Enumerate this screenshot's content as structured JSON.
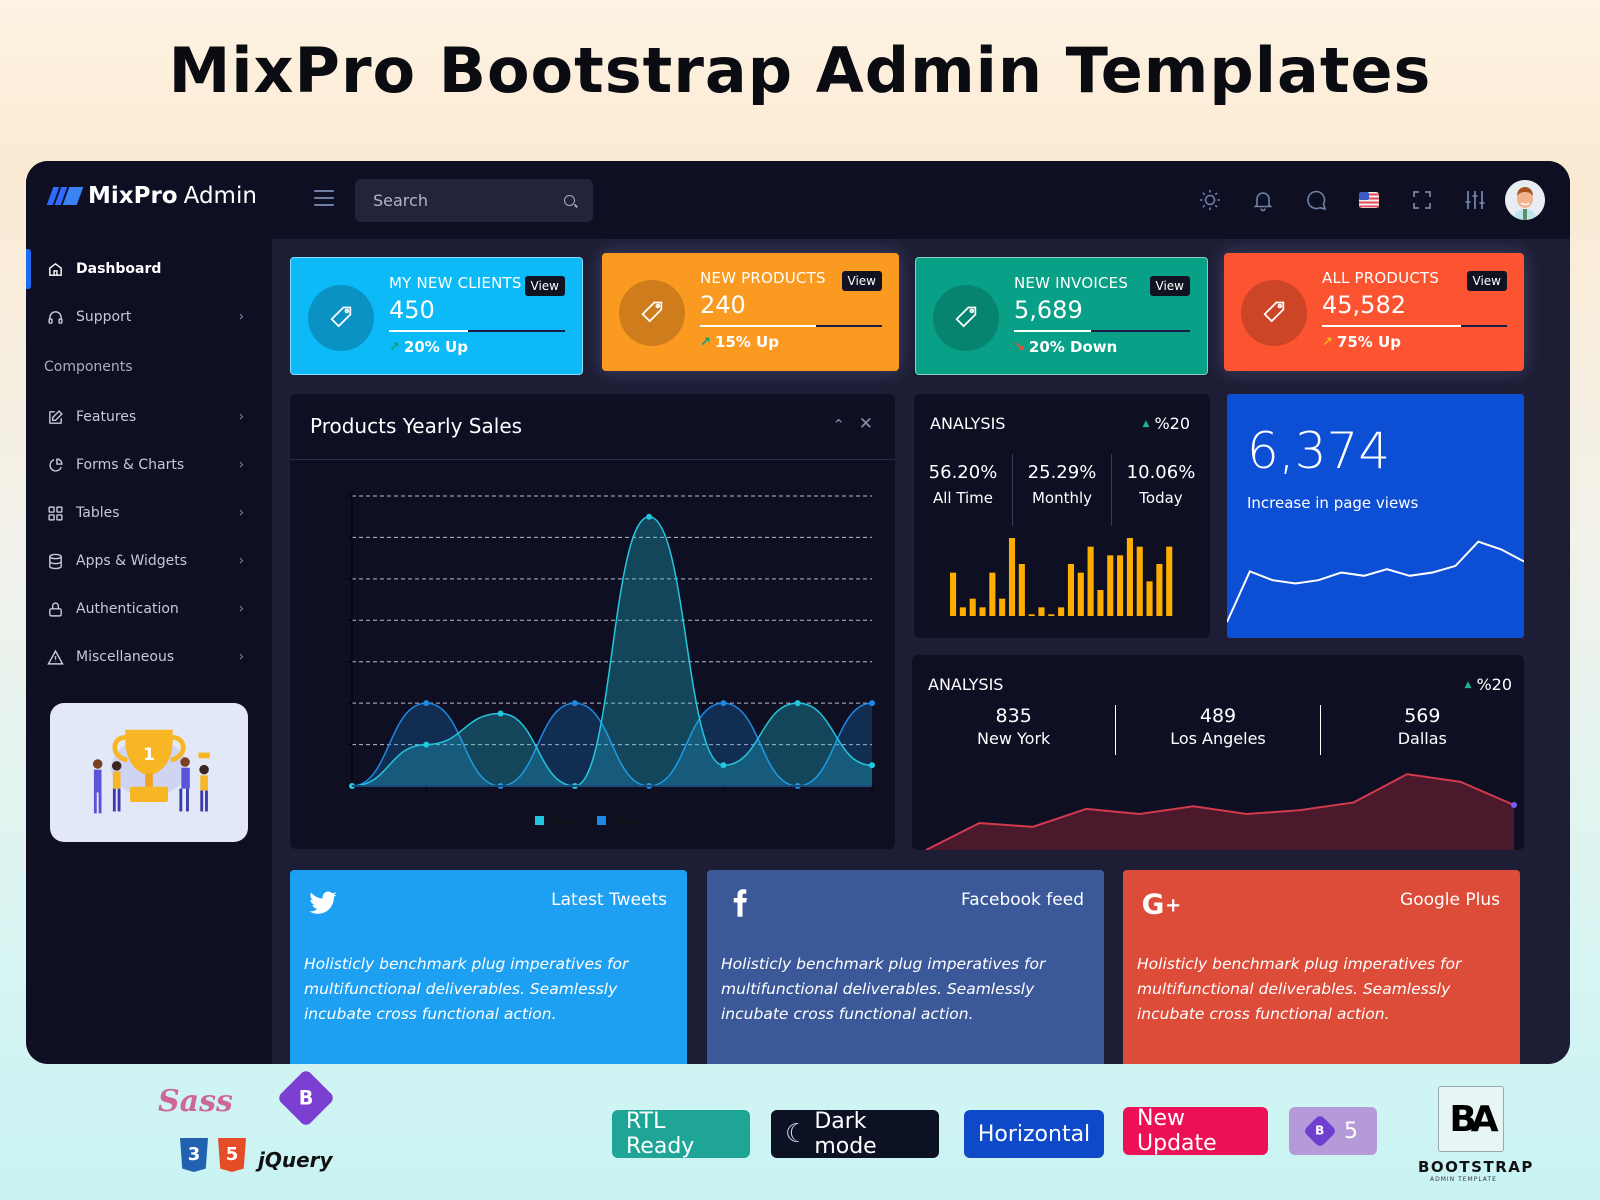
{
  "promo": {
    "title": "MixPro Bootstrap Admin Templates",
    "badges": [
      {
        "label": "RTL Ready",
        "color": "#1fa596"
      },
      {
        "label": "Dark mode",
        "color": "#0d1124"
      },
      {
        "label": "Horizontal",
        "color": "#0d49c8"
      },
      {
        "label": "New Update",
        "color": "#ec1057"
      },
      {
        "label": "5",
        "color": "#b49ad9"
      }
    ],
    "tech_logos": [
      "Sass",
      "CSS3",
      "HTML5",
      "Bootstrap",
      "jQuery"
    ],
    "bootstrap_logo_text": "BOOTSTRAP",
    "bootstrap_logo_sub": "ADMIN TEMPLATE",
    "bootstrap_logo_mark": "BA"
  },
  "app": {
    "brand": {
      "name": "MixPro",
      "suffix": "Admin"
    },
    "search": {
      "placeholder": "Search"
    },
    "top_icons": [
      "sun-icon",
      "bell-icon",
      "chat-icon",
      "us-flag-icon",
      "fullscreen-icon",
      "sliders-icon",
      "avatar"
    ],
    "sidebar": {
      "items": [
        {
          "label": "Dashboard",
          "icon": "home-icon",
          "active": true,
          "chevron": false
        },
        {
          "label": "Support",
          "icon": "headphones-icon",
          "active": false,
          "chevron": true
        }
      ],
      "section": "Components",
      "component_items": [
        {
          "label": "Features",
          "icon": "edit-icon",
          "chevron": true
        },
        {
          "label": "Forms & Charts",
          "icon": "pie-chart-icon",
          "chevron": true
        },
        {
          "label": "Tables",
          "icon": "grid-icon",
          "chevron": true
        },
        {
          "label": "Apps & Widgets",
          "icon": "database-icon",
          "chevron": true
        },
        {
          "label": "Authentication",
          "icon": "lock-icon",
          "chevron": true
        },
        {
          "label": "Miscellaneous",
          "icon": "warning-icon",
          "chevron": true
        }
      ],
      "promo_image": "trophy-illustration"
    },
    "stats": [
      {
        "label": "MY NEW CLIENTS",
        "value": "450",
        "trend": "20% Up",
        "direction": "up",
        "progress": 0.45,
        "color": "#0bbaf7",
        "circle": "#0a92c4",
        "view": "View"
      },
      {
        "label": "NEW PRODUCTS",
        "value": "240",
        "trend": "15% Up",
        "direction": "up",
        "progress": 0.64,
        "color": "#fb9a20",
        "circle": "#cf7c1c",
        "view": "View"
      },
      {
        "label": "NEW INVOICES",
        "value": "5,689",
        "trend": "20% Down",
        "direction": "down",
        "progress": 0.44,
        "color": "#09a088",
        "circle": "#078470",
        "view": "View"
      },
      {
        "label": "ALL PRODUCTS",
        "value": "45,582",
        "trend": "75% Up",
        "direction": "up",
        "progress": 0.75,
        "color": "#fc5430",
        "circle": "#cc4527",
        "view": "View"
      }
    ],
    "sales_panel": {
      "title": "Products Yearly Sales"
    },
    "analysis1": {
      "title": "ANALYSIS",
      "change": "%20",
      "metrics": [
        {
          "value": "56.20%",
          "label": "All Time"
        },
        {
          "value": "25.29%",
          "label": "Monthly"
        },
        {
          "value": "10.06%",
          "label": "Today"
        }
      ]
    },
    "pageviews": {
      "value": "6,374",
      "label": "Increase in page views"
    },
    "analysis2": {
      "title": "ANALYSIS",
      "change": "%20",
      "cities": [
        {
          "value": "835",
          "label": "New York"
        },
        {
          "value": "489",
          "label": "Los Angeles"
        },
        {
          "value": "569",
          "label": "Dallas"
        }
      ]
    },
    "social": [
      {
        "name": "Latest Tweets",
        "icon": "twitter-icon",
        "color": "#1da0f2",
        "text": "Holisticly benchmark plug imperatives for multifunctional deliverables. Seamlessly incubate cross functional action."
      },
      {
        "name": "Facebook feed",
        "icon": "facebook-icon",
        "color": "#3b5998",
        "text": "Holisticly benchmark plug imperatives for multifunctional deliverables. Seamlessly incubate cross functional action."
      },
      {
        "name": "Google Plus",
        "icon": "google-plus-icon",
        "color": "#dd4b39",
        "text": "Holisticly benchmark plug imperatives for multifunctional deliverables. Seamlessly incubate cross functional action."
      }
    ]
  },
  "chart_data": [
    {
      "type": "area",
      "title": "Products Yearly Sales",
      "x": [
        0,
        1,
        2,
        3,
        4,
        5,
        6,
        7
      ],
      "xlim": [
        0,
        7
      ],
      "ylim": [
        0,
        14
      ],
      "yticks": [
        0,
        2,
        4,
        6,
        8,
        10,
        12,
        14
      ],
      "grid": true,
      "legend": "bottom",
      "series": [
        {
          "name": "data1",
          "color": "#22c6dd",
          "values": [
            0,
            2,
            3.5,
            0,
            13,
            1,
            4,
            1
          ]
        },
        {
          "name": "data2",
          "color": "#1e88e5",
          "values": [
            0,
            4,
            0,
            4,
            0,
            4,
            0,
            4
          ]
        }
      ]
    },
    {
      "type": "bar",
      "title": "ANALYSIS",
      "color": "#ffae00",
      "values": [
        5,
        1,
        2,
        1,
        5,
        2,
        9,
        6,
        0.2,
        1,
        0.2,
        1,
        6,
        5,
        8,
        3,
        7,
        7,
        9,
        8,
        4,
        6,
        8
      ],
      "ylim": [
        0,
        9
      ]
    },
    {
      "type": "line",
      "title": "Increase in page views",
      "color": "#ffffff",
      "values": [
        1,
        5.6,
        4.8,
        4.5,
        4.8,
        5.5,
        5.2,
        5.8,
        5.2,
        5.5,
        6.1,
        8.3,
        7.6,
        6.5
      ],
      "ylim": [
        0,
        10
      ]
    },
    {
      "type": "area",
      "title": "ANALYSIS",
      "color": "#d23a4e",
      "values": [
        0,
        2.1,
        1.8,
        3.2,
        2.8,
        3.4,
        2.8,
        3.1,
        3.7,
        5.9,
        5.3,
        3.5
      ],
      "ylim": [
        0,
        7
      ]
    }
  ]
}
